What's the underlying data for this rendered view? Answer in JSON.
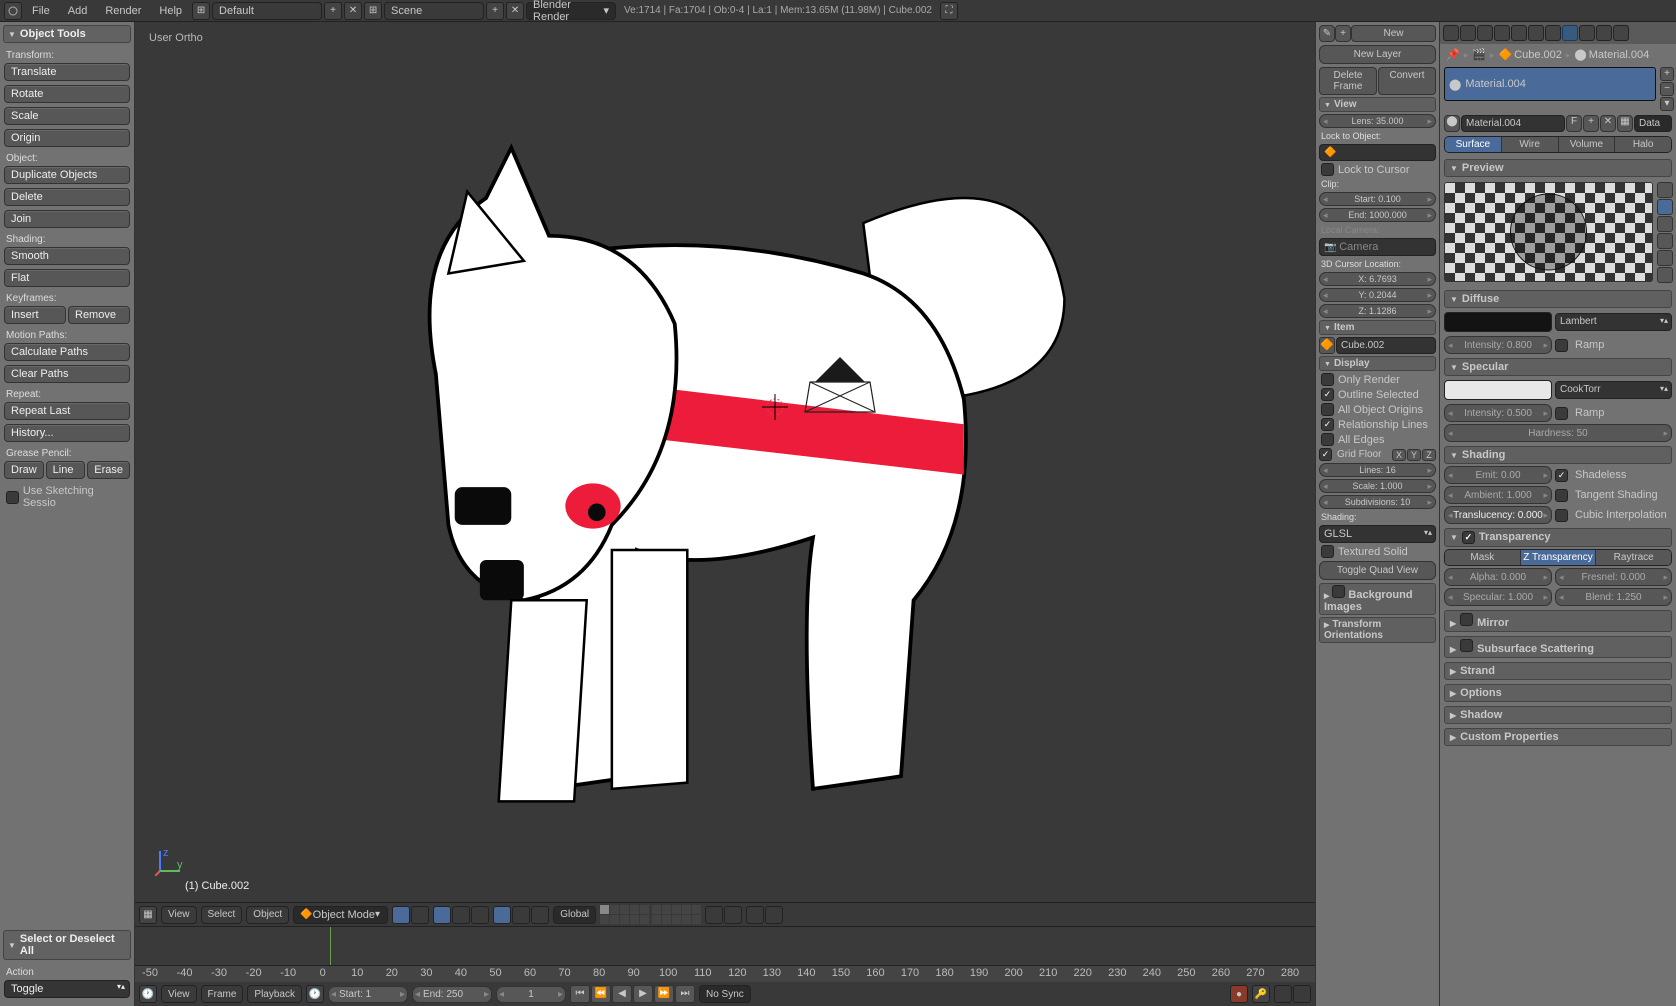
{
  "topbar": {
    "menus": [
      "File",
      "Add",
      "Render",
      "Help"
    ],
    "layout": "Default",
    "scene": "Scene",
    "engine": "Blender Render",
    "stats": "Ve:1714 | Fa:1704 | Ob:0-4 | La:1 | Mem:13.65M (11.98M) | Cube.002"
  },
  "tool_shelf": {
    "title": "Object Tools",
    "transform_label": "Transform:",
    "translate": "Translate",
    "rotate": "Rotate",
    "scale": "Scale",
    "origin": "Origin",
    "object_label": "Object:",
    "duplicate": "Duplicate Objects",
    "delete": "Delete",
    "join": "Join",
    "shading_label": "Shading:",
    "smooth": "Smooth",
    "flat": "Flat",
    "keyframes_label": "Keyframes:",
    "insert": "Insert",
    "remove": "Remove",
    "motion_label": "Motion Paths:",
    "calc_paths": "Calculate Paths",
    "clear_paths": "Clear Paths",
    "repeat_label": "Repeat:",
    "repeat_last": "Repeat Last",
    "history": "History...",
    "grease_label": "Grease Pencil:",
    "draw": "Draw",
    "line": "Line",
    "erase": "Erase",
    "sketching": "Use Sketching Sessio",
    "operator_title": "Select or Deselect All",
    "action_label": "Action",
    "action_value": "Toggle"
  },
  "viewport": {
    "ortho": "User Ortho",
    "object_label": "(1) Cube.002",
    "header": {
      "view": "View",
      "select": "Select",
      "object": "Object",
      "mode": "Object Mode",
      "orientation": "Global"
    }
  },
  "npanel": {
    "new": "New",
    "new_layer": "New Layer",
    "delete_frame": "Delete Frame",
    "convert": "Convert",
    "view_hdr": "View",
    "lens": "Lens: 35.000",
    "lock_label": "Lock to Object:",
    "lock_cursor": "Lock to Cursor",
    "clip_label": "Clip:",
    "clip_start": "Start: 0.100",
    "clip_end": "End: 1000.000",
    "local_cam_label": "Local Camera:",
    "camera": "Camera",
    "cursor_label": "3D Cursor Location:",
    "cx": "X: 6.7693",
    "cy": "Y: 0.2044",
    "cz": "Z: 1.1286",
    "item_hdr": "Item",
    "item_name": "Cube.002",
    "display_hdr": "Display",
    "only_render": "Only Render",
    "outline_sel": "Outline Selected",
    "all_origins": "All Object Origins",
    "rel_lines": "Relationship Lines",
    "all_edges": "All Edges",
    "grid_floor": "Grid Floor",
    "lines": "Lines: 16",
    "scale": "Scale: 1.000",
    "subdiv": "Subdivisions: 10",
    "shading_label": "Shading:",
    "shading_mode": "GLSL",
    "textured": "Textured Solid",
    "toggle_quad": "Toggle Quad View",
    "bg_images": "Background Images",
    "transform_orient": "Transform Orientations"
  },
  "props": {
    "breadcrumb_obj": "Cube.002",
    "breadcrumb_mat": "Material.004",
    "slot_name": "Material.004",
    "mat_name": "Material.004",
    "fake": "F",
    "data_link": "Data",
    "surface": "Surface",
    "wire": "Wire",
    "volume": "Volume",
    "halo": "Halo",
    "preview_hdr": "Preview",
    "diffuse_hdr": "Diffuse",
    "diff_shader": "Lambert",
    "diff_intensity": "Intensity: 0.800",
    "ramp": "Ramp",
    "specular_hdr": "Specular",
    "spec_shader": "CookTorr",
    "spec_intensity": "Intensity: 0.500",
    "spec_hardness": "Hardness: 50",
    "shading_hdr": "Shading",
    "emit": "Emit: 0.00",
    "ambient": "Ambient: 1.000",
    "trans": "Translucency: 0.000",
    "shadeless": "Shadeless",
    "tangent": "Tangent Shading",
    "cubic": "Cubic Interpolation",
    "transparency_hdr": "Transparency",
    "mask": "Mask",
    "ztrans": "Z Transparency",
    "raytrace": "Raytrace",
    "alpha": "Alpha: 0.000",
    "spec_alpha": "Specular: 1.000",
    "fresnel": "Fresnel: 0.000",
    "blend": "Blend: 1.250",
    "mirror_hdr": "Mirror",
    "sss_hdr": "Subsurface Scattering",
    "strand_hdr": "Strand",
    "options_hdr": "Options",
    "shadow_hdr": "Shadow",
    "custom_hdr": "Custom Properties"
  },
  "timeline": {
    "ticks": [
      -50,
      -40,
      -30,
      -20,
      -10,
      0,
      10,
      20,
      30,
      40,
      50,
      60,
      70,
      80,
      90,
      100,
      110,
      120,
      130,
      140,
      150,
      160,
      170,
      180,
      190,
      200,
      210,
      220,
      230,
      240,
      250,
      260,
      270,
      280
    ],
    "view": "View",
    "frame": "Frame",
    "playback": "Playback",
    "start": "Start: 1",
    "end": "End: 250",
    "current": "1",
    "sync": "No Sync"
  }
}
